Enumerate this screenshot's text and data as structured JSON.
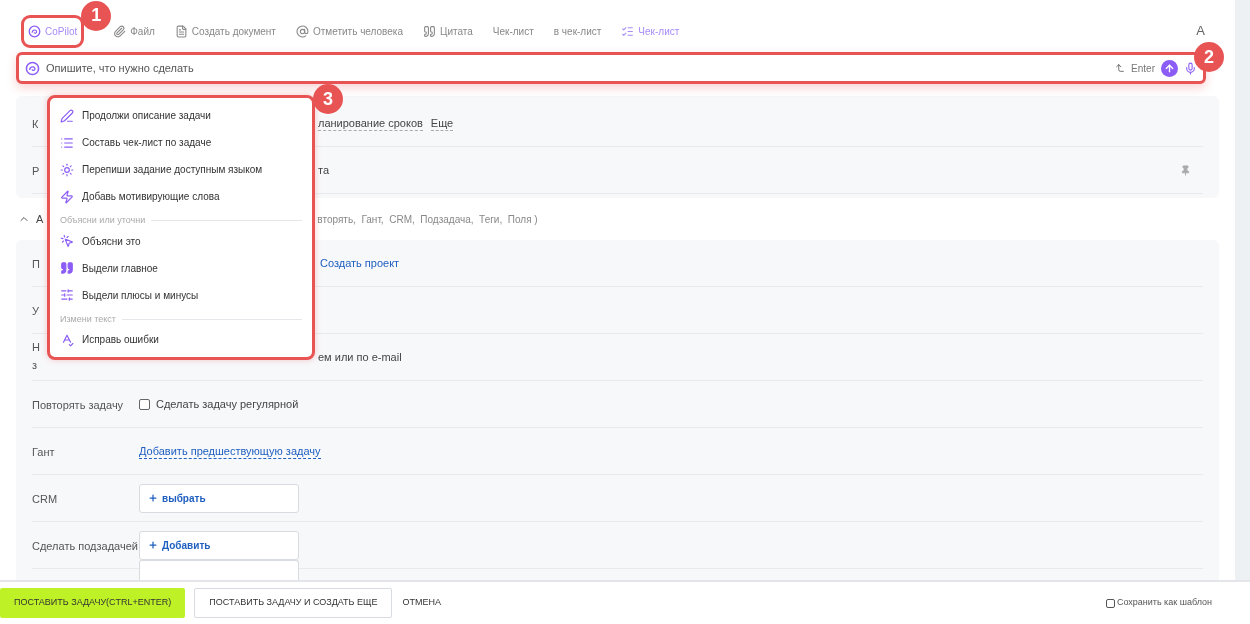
{
  "toolbar": {
    "items": [
      {
        "label": "CoPilot",
        "kind": "logo",
        "highlighted": true,
        "callout": "1"
      },
      {
        "label": "Файл",
        "kind": "clip",
        "highlighted": false
      },
      {
        "label": "Создать документ",
        "kind": "doc",
        "highlighted": false
      },
      {
        "label": "Отметить человека",
        "kind": "at",
        "highlighted": false
      },
      {
        "label": "Цитата",
        "kind": "quote",
        "highlighted": false
      },
      {
        "label": "Чек-лист",
        "kind": "plain",
        "highlighted": false
      },
      {
        "label": "в чек-лист",
        "kind": "plain",
        "highlighted": false
      },
      {
        "label": "Чек-лист",
        "kind": "checklist",
        "highlighted": true
      }
    ],
    "trailing": "A"
  },
  "prompt": {
    "placeholder": "Опишите, что нужно сделать",
    "hint": "Enter",
    "callout": "2"
  },
  "menu": {
    "callout": "3",
    "groups": [
      {
        "items": [
          {
            "label": "Продолжи описание задачи",
            "kind": "pen"
          },
          {
            "label": "Составь чек-лист по задаче",
            "kind": "list"
          },
          {
            "label": "Перепиши задание доступным языком",
            "kind": "sun"
          },
          {
            "label": "Добавь мотивирующие слова",
            "kind": "bolt"
          }
        ]
      },
      {
        "header": "Объясни или уточни",
        "items": [
          {
            "label": "Объясни это",
            "kind": "cursor"
          },
          {
            "label": "Выдели главное",
            "kind": "quote"
          },
          {
            "label": "Выдели плюсы и минусы",
            "kind": "sliders"
          }
        ]
      },
      {
        "header": "Измени текст",
        "items": [
          {
            "label": "Исправь ошибки",
            "kind": "spell"
          }
        ]
      }
    ]
  },
  "card_1": {
    "rows": [
      {
        "label": "К",
        "kind": "links",
        "links": [
          "ланирование сроков",
          "Еще"
        ]
      },
      {
        "label": "Р",
        "kind": "text",
        "text": "та",
        "pin": true
      }
    ]
  },
  "section": {
    "label": "А",
    "text": "вторять,  Гант,  CRM,  Подзадача,  Теги,  Поля )",
    "expanded": true
  },
  "card_2": {
    "rows": [
      {
        "label": "П",
        "kind": "link",
        "link": "Создать проект"
      },
      {
        "label": "У",
        "kind": "empty"
      },
      {
        "label": "Н\nз",
        "kind": "text",
        "text": "ем или по e-mail"
      },
      {
        "label": "Повторять задачу",
        "kind": "checkbox",
        "text": "Сделать задачу регулярной",
        "checked": false
      },
      {
        "label": "Гант",
        "kind": "dashed_link",
        "link": "Добавить предшествующую задачу"
      },
      {
        "label": "CRM",
        "kind": "picker",
        "text": "выбрать"
      },
      {
        "label": "Сделать подзадачей",
        "kind": "picker",
        "text": "Добавить"
      },
      {
        "kind": "picker_cut"
      }
    ]
  },
  "footer": {
    "primary": "ПОСТАВИТЬ ЗАДАЧУ(CTRL+ENTER)",
    "secondary": "ПОСТАВИТЬ ЗАДАЧУ И СОЗДАТЬ ЕЩЕ",
    "cancel": "ОТМЕНА",
    "template": {
      "label": "Сохранить как шаблон",
      "checked": false
    }
  }
}
